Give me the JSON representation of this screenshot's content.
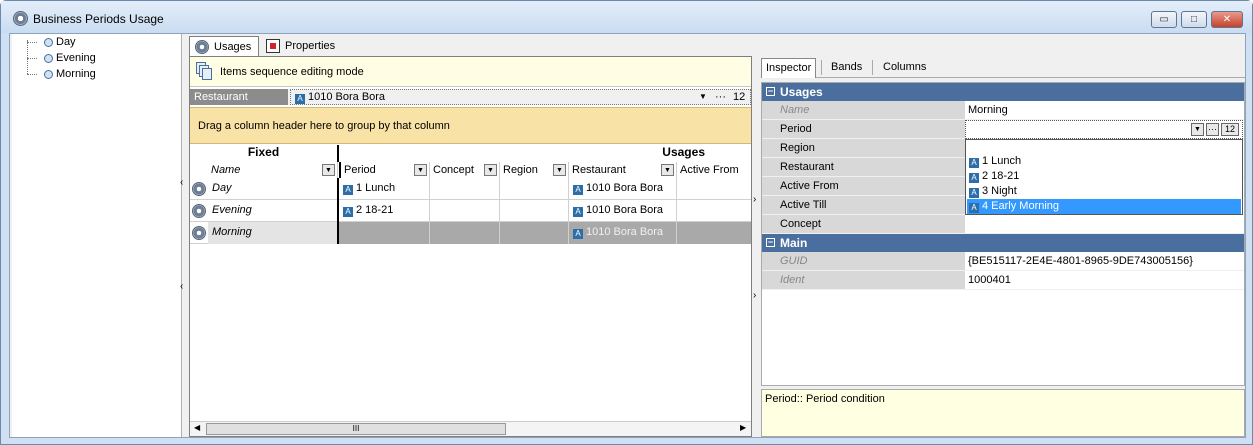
{
  "window": {
    "title": "Business Periods Usage",
    "buttons": {
      "minimize": "▭",
      "maximize": "□",
      "close": "✕"
    }
  },
  "tree": {
    "items": [
      {
        "label": "Day"
      },
      {
        "label": "Evening"
      },
      {
        "label": "Morning"
      }
    ]
  },
  "tabs": [
    {
      "label": "Usages"
    },
    {
      "label": "Properties"
    }
  ],
  "sequence_bar": {
    "label": "Items sequence editing mode"
  },
  "restaurant_filter": {
    "label": "Restaurant",
    "value": "1010 Bora Bora",
    "dropdown": "▼",
    "ellipsis": "···",
    "number": "12"
  },
  "group_panel": {
    "text": "Drag a column header here to group by that column"
  },
  "grid": {
    "band_fixed": "Fixed",
    "band_usages": "Usages",
    "columns": {
      "name": "Name",
      "period": "Period",
      "concept": "Concept",
      "region": "Region",
      "restaurant": "Restaurant",
      "active_from": "Active From"
    },
    "rows": [
      {
        "name": "Day",
        "period": "1 Lunch",
        "restaurant": "1010 Bora Bora"
      },
      {
        "name": "Evening",
        "period": "2 18-21",
        "restaurant": "1010 Bora Bora"
      },
      {
        "name": "Morning",
        "period": "",
        "restaurant": "1010 Bora Bora"
      }
    ],
    "scroll_thumb": "III"
  },
  "inspector": {
    "tabs": [
      {
        "label": "Inspector"
      },
      {
        "label": "Bands"
      },
      {
        "label": "Columns"
      }
    ],
    "categories": {
      "usages": "Usages",
      "main": "Main"
    },
    "props": {
      "name": {
        "label": "Name",
        "value": "Morning"
      },
      "period": {
        "label": "Period",
        "value": ""
      },
      "region": {
        "label": "Region"
      },
      "restaurant": {
        "label": "Restaurant"
      },
      "active_from": {
        "label": "Active From"
      },
      "active_till": {
        "label": "Active Till"
      },
      "concept": {
        "label": "Concept"
      },
      "guid": {
        "label": "GUID",
        "value": "{BE515117-2E4E-4801-8965-9DE743005156}"
      },
      "ident": {
        "label": "Ident",
        "value": "1000401"
      }
    },
    "editor_number": "12",
    "period_options": [
      {
        "label": "1 Lunch"
      },
      {
        "label": "2 18-21"
      },
      {
        "label": "3 Night"
      },
      {
        "label": "4 Early Morning"
      }
    ],
    "description": "Period:: Period condition"
  },
  "icons": {
    "entity": "A"
  }
}
